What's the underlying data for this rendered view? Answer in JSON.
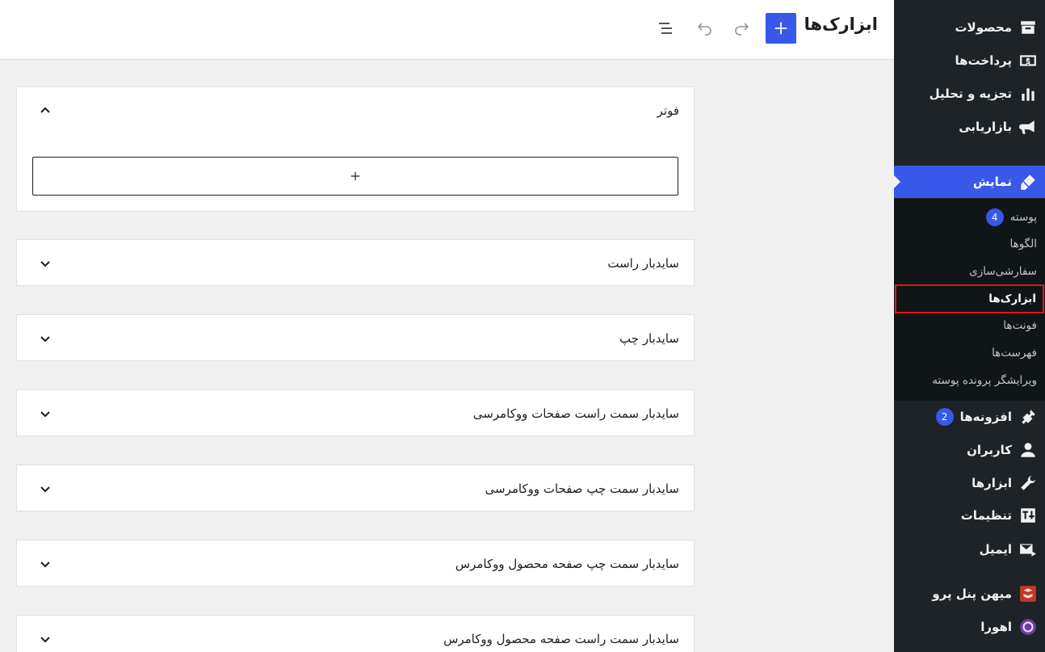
{
  "header": {
    "title": "ابزارک‌ها",
    "add_icon": "plus-icon",
    "redo_icon": "redo-icon",
    "undo_icon": "undo-icon",
    "list_view_icon": "list-view-icon"
  },
  "panels": [
    {
      "title": "فوتر",
      "expanded": true
    },
    {
      "title": "سایدبار راست",
      "expanded": false
    },
    {
      "title": "سایدبار چپ",
      "expanded": false
    },
    {
      "title": "سایدبار سمت راست صفحات ووکامرسی",
      "expanded": false
    },
    {
      "title": "سایدبار سمت چپ صفحات ووکامرسی",
      "expanded": false
    },
    {
      "title": "سایدبار سمت چپ صفحه محصول ووکامرس",
      "expanded": false
    },
    {
      "title": "سایدبار سمت راست صفحه محصول ووکامرس",
      "expanded": false
    }
  ],
  "sidebar": {
    "menu": [
      {
        "label": "محصولات",
        "icon": "archive-icon"
      },
      {
        "label": "پرداخت‌ها",
        "icon": "money-icon"
      },
      {
        "label": "تجزیه و تحلیل",
        "icon": "chart-bar-icon"
      },
      {
        "label": "بازاریابی",
        "icon": "megaphone-icon"
      },
      {
        "label": "نمایش",
        "icon": "paintbrush-icon"
      },
      {
        "label": "افزونه‌ها",
        "icon": "plugin-icon",
        "badge": "2"
      },
      {
        "label": "کاربران",
        "icon": "user-icon"
      },
      {
        "label": "ابزارها",
        "icon": "wrench-icon"
      },
      {
        "label": "تنظیمات",
        "icon": "settings-icon"
      },
      {
        "label": "ایمیل",
        "icon": "email-icon"
      },
      {
        "label": "میهن پنل پرو",
        "icon": "mihanpanel-icon"
      },
      {
        "label": "اهورا",
        "icon": "ahura-icon"
      }
    ],
    "submenu": [
      {
        "label": "پوسته",
        "badge": "4"
      },
      {
        "label": "الگوها"
      },
      {
        "label": "سفارشی‌سازی"
      },
      {
        "label": "ابزارک‌ها"
      },
      {
        "label": "فونت‌ها"
      },
      {
        "label": "فهرست‌ها"
      },
      {
        "label": "ویرایشگر پرونده پوسته"
      }
    ],
    "colors": {
      "bg": "#1d2327",
      "submenu_bg": "#101517",
      "active": "#3858e9",
      "highlight_border": "#e0161b"
    }
  }
}
